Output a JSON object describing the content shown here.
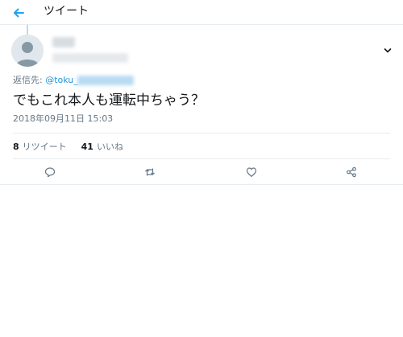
{
  "header": {
    "title": "ツイート",
    "back_icon": "back-arrow-icon"
  },
  "tweet": {
    "reply_to_label": "返信先: ",
    "reply_to_handle": "@toku_",
    "text": "でもこれ本人も運転中ちゃう？",
    "timestamp": "2018年09月11日 15:03",
    "retweets": {
      "count": "8",
      "label": "リツイート"
    },
    "likes": {
      "count": "41",
      "label": "いいね"
    }
  },
  "actions": [
    "reply-icon",
    "retweet-icon",
    "like-icon",
    "share-icon"
  ],
  "colors": {
    "accent": "#1da1f2",
    "text": "#14171a",
    "muted": "#657786",
    "border": "#e6ecf0",
    "mention": "#1b95e0"
  }
}
